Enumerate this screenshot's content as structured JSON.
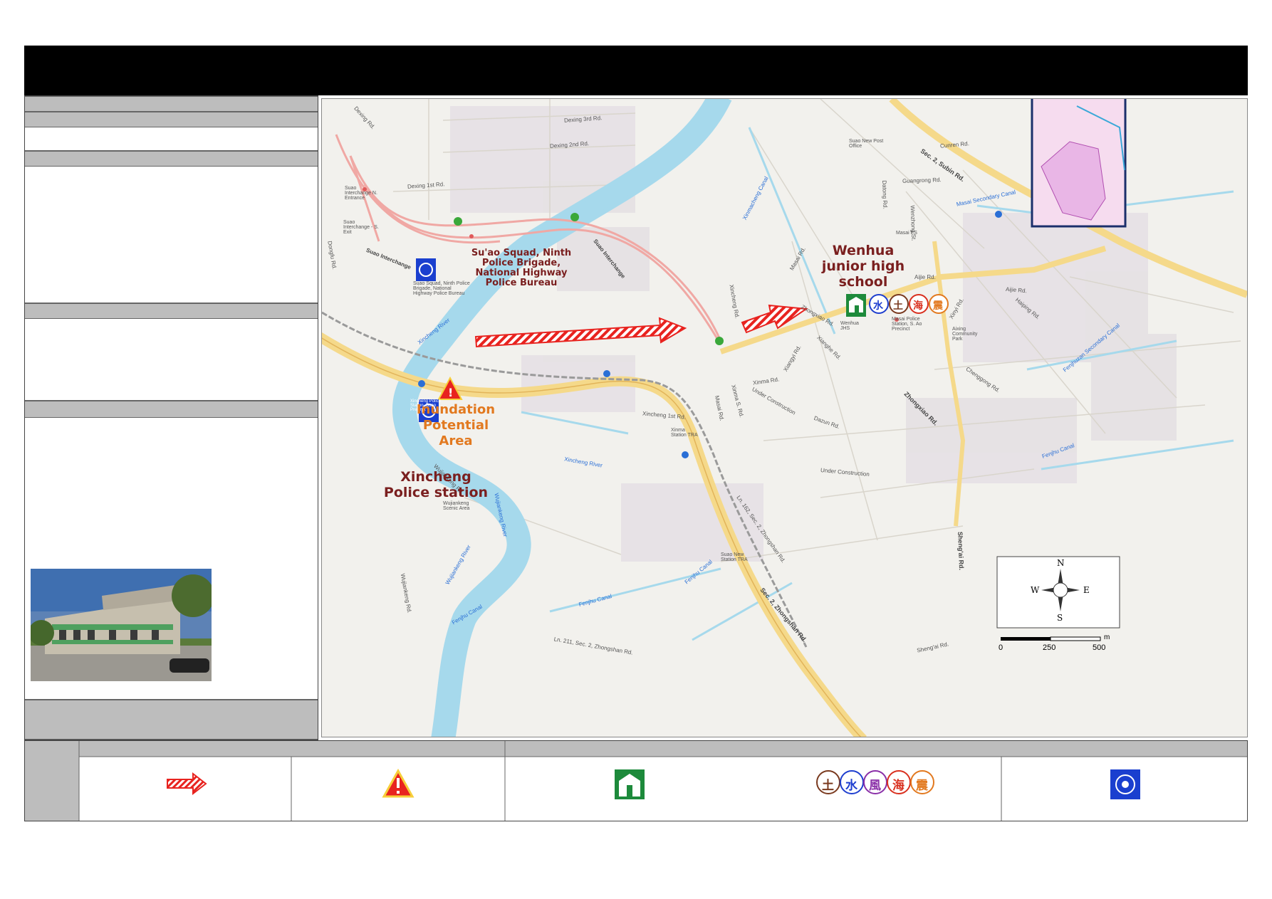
{
  "header": {
    "title": ""
  },
  "map": {
    "labels": {
      "dexing_3rd": "Dexing 3rd Rd.",
      "dexing_2nd": "Dexing 2nd Rd.",
      "dexing_1st": "Dexing 1st Rd.",
      "dexing": "Dexing Rd.",
      "suao_interchange_1": "Suao Interchange",
      "suao_interchange_2": "Suao Interchange",
      "suao_n_entrance": "Suao Interchange N. Entrance",
      "suao_s_exit": "Suao Interchange - S. Exit",
      "dongfu": "Dongfu Rd.",
      "xincheng_river_1": "Xincheng River",
      "xincheng_river_2": "Xincheng River",
      "xincheng_1st": "Xincheng 1st Rd.",
      "xinma_station": "Xinma Station TRA",
      "xinma_s": "Xinma S. Rd.",
      "xinma": "Xinma Rd.",
      "masai_rd": "Masai Rd.",
      "xincheng_rd": "Xincheng Rd.",
      "xinmacheng_canal": "Xinmacheng Canal",
      "zhongxiao_1": "Zhongxiao Rd.",
      "zhongxiao_2": "Zhongxiao Rd.",
      "xianghe": "Xianghe Rd.",
      "xiangyi": "Xiangyi Rd.",
      "under_construction_1": "Under Construction",
      "under_construction_2": "Under Construction",
      "dazun": "Dazun Rd.",
      "wujiankeng_rd": "Wujiankeng Rd.",
      "wujiankeng_river_1": "Wujiankeng River",
      "wujiankeng_river_2": "Wujiankeng River",
      "wujiankeng_scenic": "Wujiankeng Scenic Area",
      "fenjhu_canal_1": "Fenjhu Canal",
      "fenjhu_canal_2": "Fenjhu Canal",
      "fenjhu_canal_3": "Fenjhu Canal",
      "ln162": "Ln. 162, Sec. 2, Zhongshan Rd.",
      "ln211": "Ln. 211, Sec. 2, Zhongshan Rd.",
      "zhongshan_sec2": "Sec. 2, Zhongshan Rd.",
      "suao_new_station": "Suao New Station TRA",
      "suao_post": "Suao New Post Office",
      "datong": "Datong Rd.",
      "guangrong": "Guangrong Rd.",
      "sec2_subin": "Sec. 2, Subin Rd.",
      "cunren": "Cunren Rd.",
      "masai_secondary_canal": "Masai Secondary Canal",
      "wenzhong": "Wenzhong St.",
      "masai_es": "Masai ES",
      "aijie_1": "Aijie Rd.",
      "aijie_2": "Aijie Rd.",
      "haiping": "Haiping Rd.",
      "xinyi": "Xinyi Rd.",
      "masai_police": "Masai Police Station, S. Ao Precinct",
      "aixing_park": "Aixing Community Park",
      "zhongxiao_3": "Zhongxiao Rd.",
      "chenggong": "Chenggong Rd.",
      "fenjhuzan_canal": "Fenjhuzan Secondary Canal",
      "fenjhu_canal_4": "Fenjhu Canal",
      "shengai": "Sheng'ai Rd.",
      "shengai_2": "Sheng'ai Rd.",
      "wenhua_jhs_small": "Wenhua JHS",
      "suao_squad_small": "Suao Squad, Ninth Police Brigade, National Highway Police Bureau",
      "xincheng_small": "Xincheng Police Station, Suao Precinct"
    },
    "callouts": {
      "suao_squad": [
        "Su'ao Squad, Ninth",
        "Police Brigade,",
        "National Highway",
        "Police Bureau"
      ],
      "wenhua": [
        "Wenhua",
        "junior high",
        "school"
      ],
      "inundation": [
        "Inundation",
        "Potential Area"
      ],
      "xincheng": [
        "Xincheng",
        "Police station"
      ]
    },
    "hazard_glyphs": [
      "水",
      "土",
      "海",
      "震"
    ],
    "north_arrow": {
      "n": "N",
      "s": "S",
      "e": "E",
      "w": "W"
    },
    "scale_bar": {
      "ticks": [
        "0",
        "250",
        "500"
      ],
      "unit": "m"
    }
  },
  "legend": {
    "hazard_glyphs": [
      "土",
      "水",
      "風",
      "海",
      "震"
    ]
  },
  "colors": {
    "river": "#a6d9ec",
    "highway": "#f5d98a",
    "arrow_red": "#e8231f",
    "label_maroon": "#7a1f1f",
    "orange_label": "#e2791f",
    "police_blue": "#1a3fcf",
    "shelter_green": "#1d8a3b"
  }
}
